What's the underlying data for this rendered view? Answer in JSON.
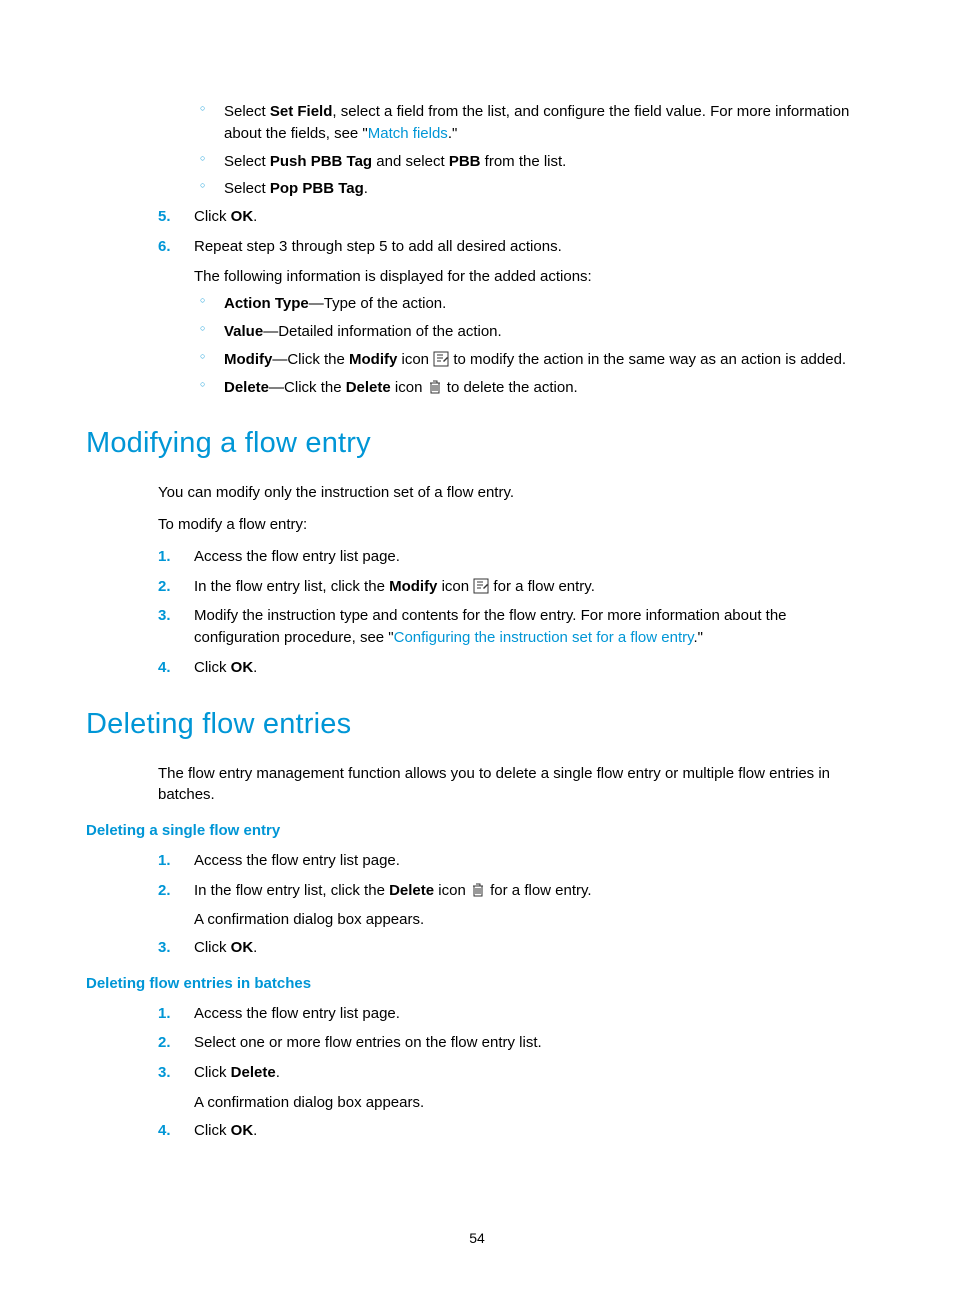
{
  "sub_a": {
    "pre": "Select ",
    "bold": "Set Field",
    "mid": ", select a field from the list, and configure the field value. For more information about the fields, see \"",
    "link": "Match fields",
    "post": ".\""
  },
  "sub_b": {
    "pre": "Select ",
    "b1": "Push PBB Tag",
    "mid": " and select ",
    "b2": "PBB",
    "post": " from the list."
  },
  "sub_c": {
    "pre": "Select ",
    "b1": "Pop PBB Tag",
    "post": "."
  },
  "step5": {
    "num": "5.",
    "pre": "Click ",
    "b": "OK",
    "post": "."
  },
  "step6": {
    "num": "6.",
    "text": "Repeat step 3 through step 5 to add all desired actions."
  },
  "step6_follow": "The following information is displayed for the added actions:",
  "info": {
    "at": {
      "b": "Action Type",
      "txt": "—Type of the action."
    },
    "val": {
      "b": "Value",
      "txt": "—Detailed information of the action."
    },
    "mod": {
      "b1": "Modify",
      "p1": "—Click the ",
      "b2": "Modify",
      "p2": " icon ",
      "p3": " to modify the action in the same way as an action is added."
    },
    "del": {
      "b1": "Delete",
      "p1": "—Click the ",
      "b2": "Delete",
      "p2": " icon ",
      "p3": " to delete the action."
    }
  },
  "h_modify": "Modifying a flow entry",
  "mod_p1": "You can modify only the instruction set of a flow entry.",
  "mod_p2": "To modify a flow entry:",
  "mod_s1": {
    "num": "1.",
    "txt": "Access the flow entry list page."
  },
  "mod_s2": {
    "num": "2.",
    "p1": "In the flow entry list, click the ",
    "b1": "Modify",
    "p2": " icon ",
    "p3": " for a flow entry."
  },
  "mod_s3": {
    "num": "3.",
    "p1": "Modify the instruction type and contents for the flow entry. For more information about the configuration procedure, see \"",
    "link": "Configuring the instruction set for a flow entry",
    "p2": ".\""
  },
  "mod_s4": {
    "num": "4.",
    "pre": "Click ",
    "b": "OK",
    "post": "."
  },
  "h_delete": "Deleting flow entries",
  "del_p1": "The flow entry management function allows you to delete a single flow entry or multiple flow entries in batches.",
  "h_del_single": "Deleting a single flow entry",
  "ds1": {
    "num": "1.",
    "txt": "Access the flow entry list page."
  },
  "ds2": {
    "num": "2.",
    "p1": "In the flow entry list, click the ",
    "b1": "Delete",
    "p2": " icon ",
    "p3": " for a flow entry."
  },
  "ds2_follow": "A confirmation dialog box appears.",
  "ds3": {
    "num": "3.",
    "pre": "Click ",
    "b": "OK",
    "post": "."
  },
  "h_del_batch": "Deleting flow entries in batches",
  "db1": {
    "num": "1.",
    "txt": "Access the flow entry list page."
  },
  "db2": {
    "num": "2.",
    "txt": "Select one or more flow entries on the flow entry list."
  },
  "db3": {
    "num": "3.",
    "pre": "Click ",
    "b": "Delete",
    "post": "."
  },
  "db3_follow": "A confirmation dialog box appears.",
  "db4": {
    "num": "4.",
    "pre": "Click ",
    "b": "OK",
    "post": "."
  },
  "page_number": "54"
}
